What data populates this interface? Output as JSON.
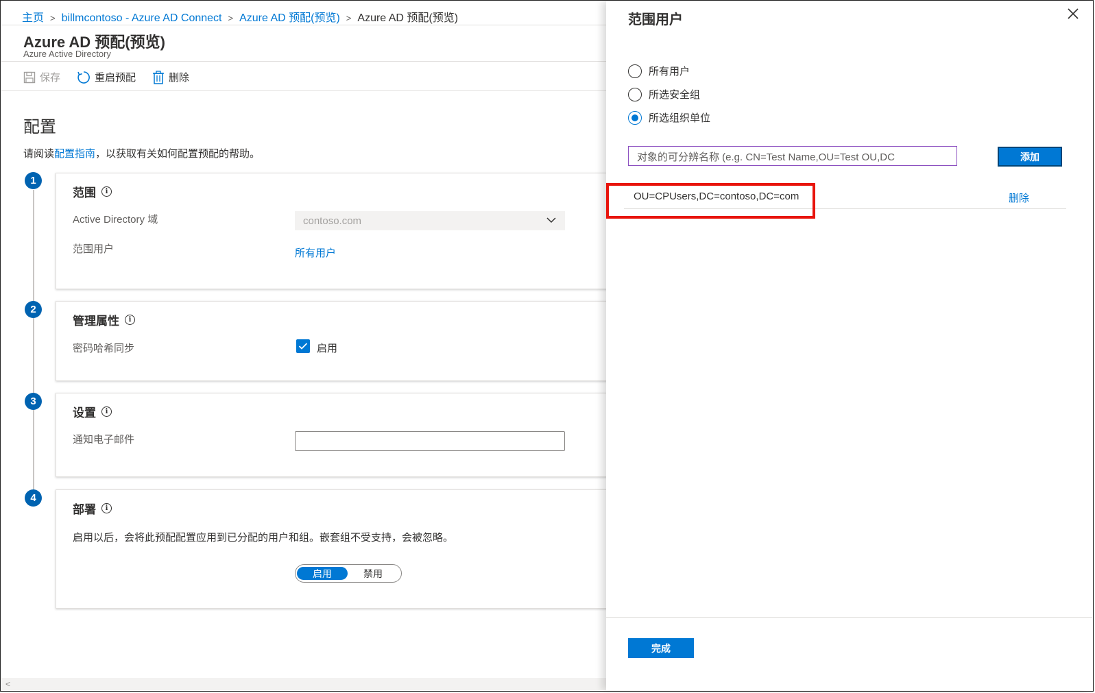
{
  "breadcrumb": {
    "items": [
      "主页",
      "billmcontoso - Azure AD Connect",
      "Azure AD 预配(预览)"
    ],
    "current": "Azure AD 预配(预览)"
  },
  "header": {
    "title": "Azure AD 预配(预览)",
    "subtitle": "Azure Active Directory"
  },
  "toolbar": {
    "save": "保存",
    "restart": "重启预配",
    "delete": "删除"
  },
  "config": {
    "title": "配置",
    "help_prefix": "请阅读",
    "help_link": "配置指南",
    "help_suffix": "，以获取有关如何配置预配的帮助。"
  },
  "steps": [
    {
      "num": "1",
      "title": "范围",
      "ad_domain_label": "Active Directory 域",
      "ad_domain_value": "contoso.com",
      "scope_users_label": "范围用户",
      "scope_users_value": "所有用户"
    },
    {
      "num": "2",
      "title": "管理属性",
      "phs_label": "密码哈希同步",
      "phs_value": "启用"
    },
    {
      "num": "3",
      "title": "设置",
      "email_label": "通知电子邮件",
      "email_value": ""
    },
    {
      "num": "4",
      "title": "部署",
      "description": "启用以后，会将此预配配置应用到已分配的用户和组。嵌套组不受支持，会被忽略。",
      "toggle_on": "启用",
      "toggle_off": "禁用"
    }
  ],
  "panel": {
    "title": "范围用户",
    "radios": [
      {
        "label": "所有用户",
        "selected": false
      },
      {
        "label": "所选安全组",
        "selected": false
      },
      {
        "label": "所选组织单位",
        "selected": true
      }
    ],
    "dn_placeholder": "对象的可分辨名称 (e.g. CN=Test Name,OU=Test OU,DC",
    "add_button": "添加",
    "entries": [
      {
        "value": "OU=CPUsers,DC=contoso,DC=com",
        "action": "删除"
      }
    ],
    "done_button": "完成"
  },
  "colors": {
    "accent": "#0078d4",
    "step_badge": "#0063b1",
    "highlight": "#e8140c",
    "input_focus": "#8b4fc0"
  }
}
